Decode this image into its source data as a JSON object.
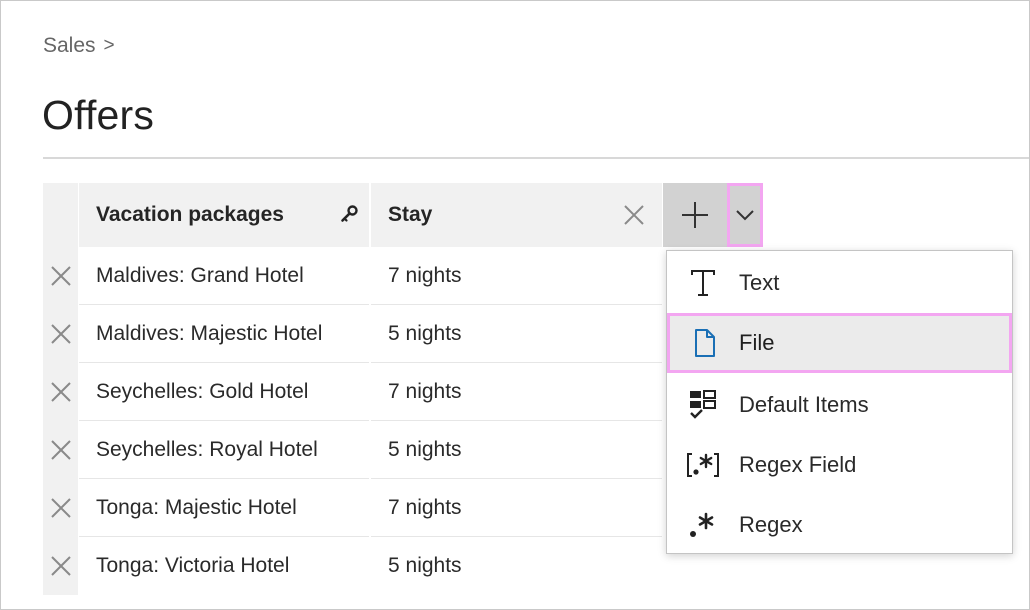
{
  "breadcrumb": {
    "root": "Sales",
    "separator": ">"
  },
  "page": {
    "title": "Offers"
  },
  "table": {
    "columns": [
      {
        "label": "Vacation packages",
        "icon": "key-icon"
      },
      {
        "label": "Stay",
        "icon": "close-icon"
      }
    ],
    "rows": [
      {
        "package": "Maldives: Grand Hotel",
        "stay": "7 nights"
      },
      {
        "package": "Maldives: Majestic Hotel",
        "stay": "5 nights"
      },
      {
        "package": "Seychelles: Gold Hotel",
        "stay": "7 nights"
      },
      {
        "package": "Seychelles: Royal Hotel",
        "stay": "5 nights"
      },
      {
        "package": "Tonga: Majestic Hotel",
        "stay": "7 nights"
      },
      {
        "package": "Tonga: Victoria Hotel",
        "stay": "5 nights"
      }
    ]
  },
  "add_column": {
    "add_icon": "plus-icon",
    "menu_icon": "chevron-down-icon"
  },
  "menu": {
    "items": [
      {
        "label": "Text",
        "icon": "text-type-icon"
      },
      {
        "label": "File",
        "icon": "file-icon",
        "selected": true
      },
      {
        "label": "Default Items",
        "icon": "default-items-icon"
      },
      {
        "label": "Regex Field",
        "icon": "regex-field-icon"
      },
      {
        "label": "Regex",
        "icon": "regex-icon"
      }
    ]
  },
  "colors": {
    "highlight": "#f3a6f1",
    "header_bg": "#f1f1f1",
    "button_bg": "#d2d2d2",
    "file_icon": "#1a6fb5"
  }
}
